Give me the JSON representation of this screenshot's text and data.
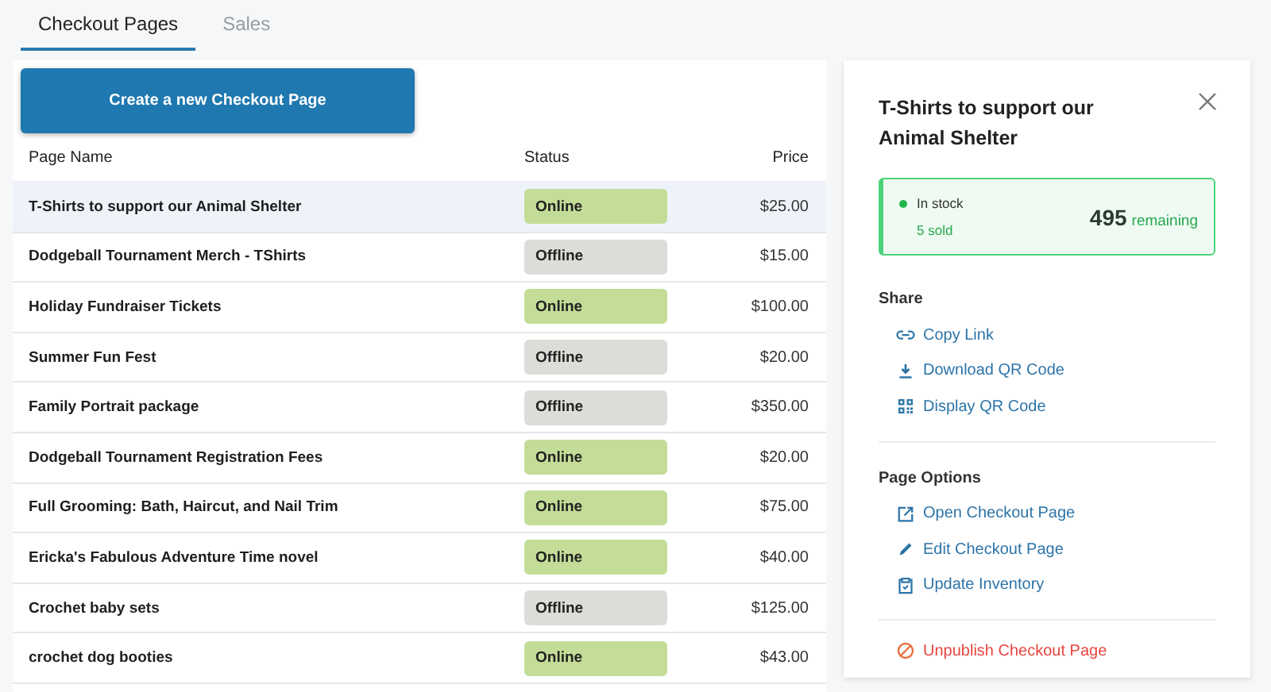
{
  "tabs": [
    {
      "label": "Checkout Pages",
      "selected": true
    },
    {
      "label": "Sales",
      "selected": false
    }
  ],
  "create_button": "Create a new Checkout Page",
  "table": {
    "columns": [
      "Page Name",
      "Status",
      "Price"
    ],
    "rows": [
      {
        "name": "T-Shirts to support our Animal Shelter",
        "status": "Online",
        "online": true,
        "price": "$25.00",
        "selected": true
      },
      {
        "name": "Dodgeball Tournament Merch - TShirts",
        "status": "Offline",
        "online": false,
        "price": "$15.00",
        "selected": false
      },
      {
        "name": "Holiday Fundraiser Tickets",
        "status": "Online",
        "online": true,
        "price": "$100.00",
        "selected": false
      },
      {
        "name": "Summer Fun Fest",
        "status": "Offline",
        "online": false,
        "price": "$20.00",
        "selected": false
      },
      {
        "name": "Family Portrait package",
        "status": "Offline",
        "online": false,
        "price": "$350.00",
        "selected": false
      },
      {
        "name": "Dodgeball Tournament Registration Fees",
        "status": "Online",
        "online": true,
        "price": "$20.00",
        "selected": false
      },
      {
        "name": "Full Grooming: Bath, Haircut, and Nail Trim",
        "status": "Online",
        "online": true,
        "price": "$75.00",
        "selected": false
      },
      {
        "name": "Ericka's Fabulous Adventure Time novel",
        "status": "Online",
        "online": true,
        "price": "$40.00",
        "selected": false
      },
      {
        "name": "Crochet baby sets",
        "status": "Offline",
        "online": false,
        "price": "$125.00",
        "selected": false
      },
      {
        "name": "crochet dog booties",
        "status": "Online",
        "online": true,
        "price": "$43.00",
        "selected": false
      }
    ]
  },
  "details": {
    "title": "T-Shirts to support our Animal Shelter",
    "stock": {
      "status": "In stock",
      "sold": "5 sold",
      "count": "495",
      "count_label": "remaining"
    },
    "sections": [
      {
        "heading": "Share",
        "actions": [
          {
            "kind": "link",
            "label": "Copy Link"
          },
          {
            "kind": "download",
            "label": "Download QR Code"
          },
          {
            "kind": "qr",
            "label": "Display QR Code"
          }
        ]
      },
      {
        "heading": "Page Options",
        "actions": [
          {
            "kind": "open",
            "label": "Open Checkout Page"
          },
          {
            "kind": "edit",
            "label": "Edit Checkout Page"
          },
          {
            "kind": "inventory",
            "label": "Update Inventory"
          }
        ]
      }
    ],
    "danger_action": "Unpublish Checkout Page"
  }
}
